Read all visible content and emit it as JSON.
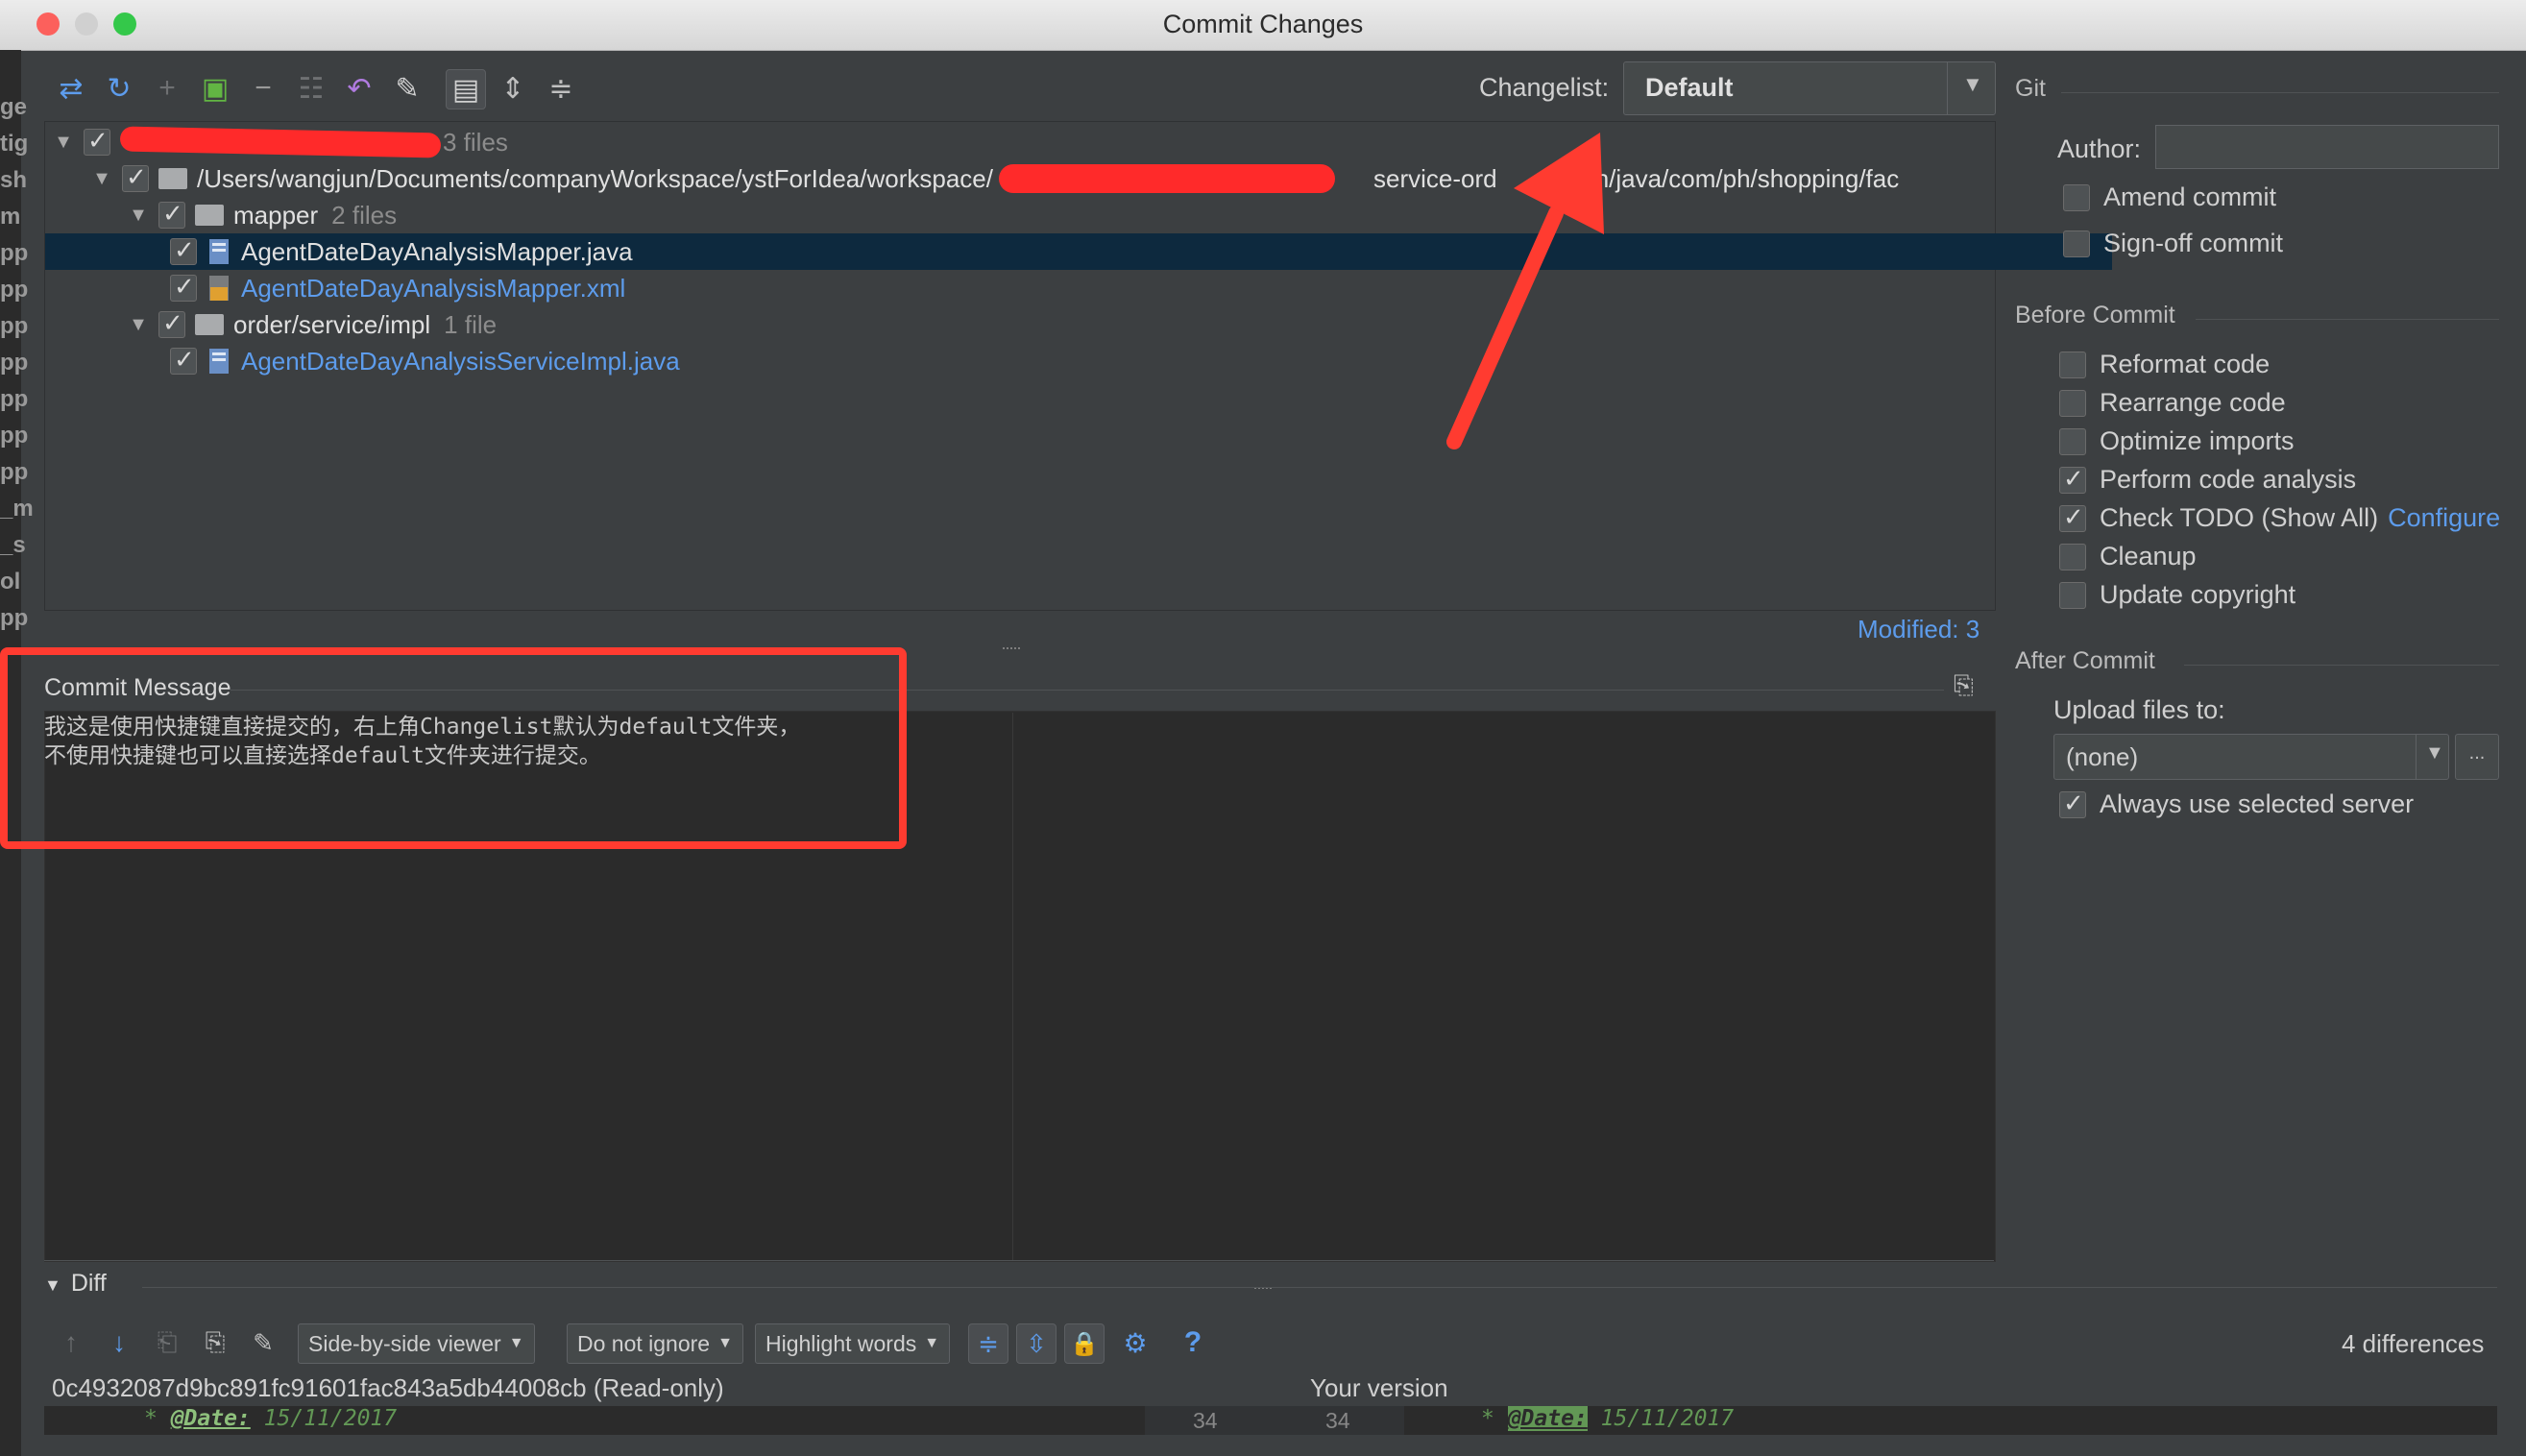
{
  "window": {
    "title": "Commit Changes"
  },
  "toolbar": {
    "icons": [
      "diff-arrows-icon",
      "refresh-icon",
      "add-icon",
      "move-changelist-icon",
      "remove-icon",
      "group-icon",
      "rollback-icon",
      "edit-source-icon",
      "preview-diff-icon",
      "expand-all-icon",
      "collapse-all-icon"
    ],
    "changelist_label": "Changelist:",
    "changelist_value": "Default"
  },
  "tree": {
    "root_count": "3 files",
    "path": "/Users/wangjun/Documents/companyWorkspace/ystForIdea/workspace/",
    "path_tail": "service-ord",
    "path_end": "c/main/java/com/ph/shopping/fac",
    "mapper": {
      "name": "mapper",
      "count": "2 files"
    },
    "file1": "AgentDateDayAnalysisMapper.java",
    "file2": "AgentDateDayAnalysisMapper.xml",
    "impl": {
      "name": "order/service/impl",
      "count": "1 file"
    },
    "file3": "AgentDateDayAnalysisServiceImpl.java",
    "modified": "Modified: 3"
  },
  "git": {
    "title": "Git",
    "author_label": "Author:",
    "author_value": "",
    "amend": "Amend commit",
    "signoff": "Sign-off commit"
  },
  "before_commit": {
    "title": "Before Commit",
    "options": [
      {
        "label": "Reformat code",
        "checked": false
      },
      {
        "label": "Rearrange code",
        "checked": false
      },
      {
        "label": "Optimize imports",
        "checked": false
      },
      {
        "label": "Perform code analysis",
        "checked": true
      },
      {
        "label": "Check TODO (Show All)",
        "checked": true
      },
      {
        "label": "Cleanup",
        "checked": false
      },
      {
        "label": "Update copyright",
        "checked": false
      }
    ],
    "configure_link": "Configure"
  },
  "after_commit": {
    "title": "After Commit",
    "upload_label": "Upload files to:",
    "upload_value": "(none)",
    "more_button": "...",
    "always_use": "Always use selected server"
  },
  "commit_message": {
    "label": "Commit Message",
    "text": "我这是使用快捷键直接提交的，右上角Changelist默认为default文件夹，\n不使用快捷键也可以直接选择default文件夹进行提交。"
  },
  "diff": {
    "label": "Diff",
    "viewer": "Side-by-side viewer",
    "ignore": "Do not ignore",
    "highlight": "Highlight words",
    "help": "?",
    "differences": "4 differences",
    "left_title": "0c4932087d9bc891fc91601fac843a5db44008cb (Read-only)",
    "right_title": "Your version",
    "line_left": "34",
    "line_right": "34",
    "code_left_tag": "@Date:",
    "code_left_val": "15/11/2017",
    "code_right_tag": "@Date:",
    "code_right_val": "15/11/2017"
  },
  "colors": {
    "accent": "#5d9cec",
    "annotation": "#ff3b30",
    "selection": "#0d293e"
  }
}
